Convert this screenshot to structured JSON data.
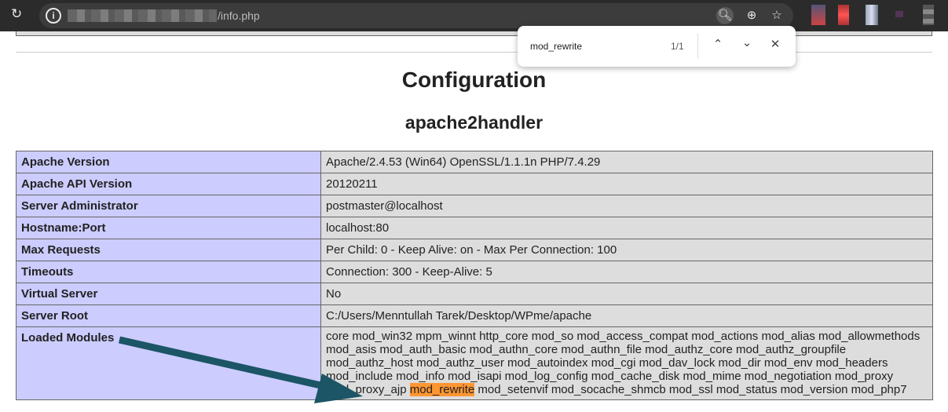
{
  "browser": {
    "url_visible": "/info.php",
    "find": {
      "query": "mod_rewrite",
      "count": "1/1"
    }
  },
  "page": {
    "title": "Configuration",
    "section": "apache2handler",
    "rows": [
      {
        "label": "Apache Version",
        "value": "Apache/2.4.53 (Win64) OpenSSL/1.1.1n PHP/7.4.29"
      },
      {
        "label": "Apache API Version",
        "value": "20120211"
      },
      {
        "label": "Server Administrator",
        "value": "postmaster@localhost"
      },
      {
        "label": "Hostname:Port",
        "value": "localhost:80"
      },
      {
        "label": "Max Requests",
        "value": "Per Child: 0 - Keep Alive: on - Max Per Connection: 100"
      },
      {
        "label": "Timeouts",
        "value": "Connection: 300 - Keep-Alive: 5"
      },
      {
        "label": "Virtual Server",
        "value": "No"
      },
      {
        "label": "Server Root",
        "value": "C:/Users/Menntullah Tarek/Desktop/WPme/apache"
      }
    ],
    "modules": {
      "label": "Loaded Modules",
      "before": "core mod_win32 mpm_winnt http_core mod_so mod_access_compat mod_actions mod_alias mod_allowmethods mod_asis mod_auth_basic mod_authn_core mod_authn_file mod_authz_core mod_authz_groupfile mod_authz_host mod_authz_user mod_autoindex mod_cgi mod_dav_lock mod_dir mod_env mod_headers mod_include mod_info mod_isapi mod_log_config mod_cache_disk mod_mime mod_negotiation mod_proxy mod_proxy_ajp ",
      "match": "mod_rewrite",
      "after": " mod_setenvif mod_socache_shmcb mod_ssl mod_status mod_version mod_php7"
    }
  },
  "colors": {
    "highlight": "#ff9632",
    "label_bg": "#ccccff",
    "value_bg": "#dddddd",
    "arrow": "#1b5566"
  }
}
